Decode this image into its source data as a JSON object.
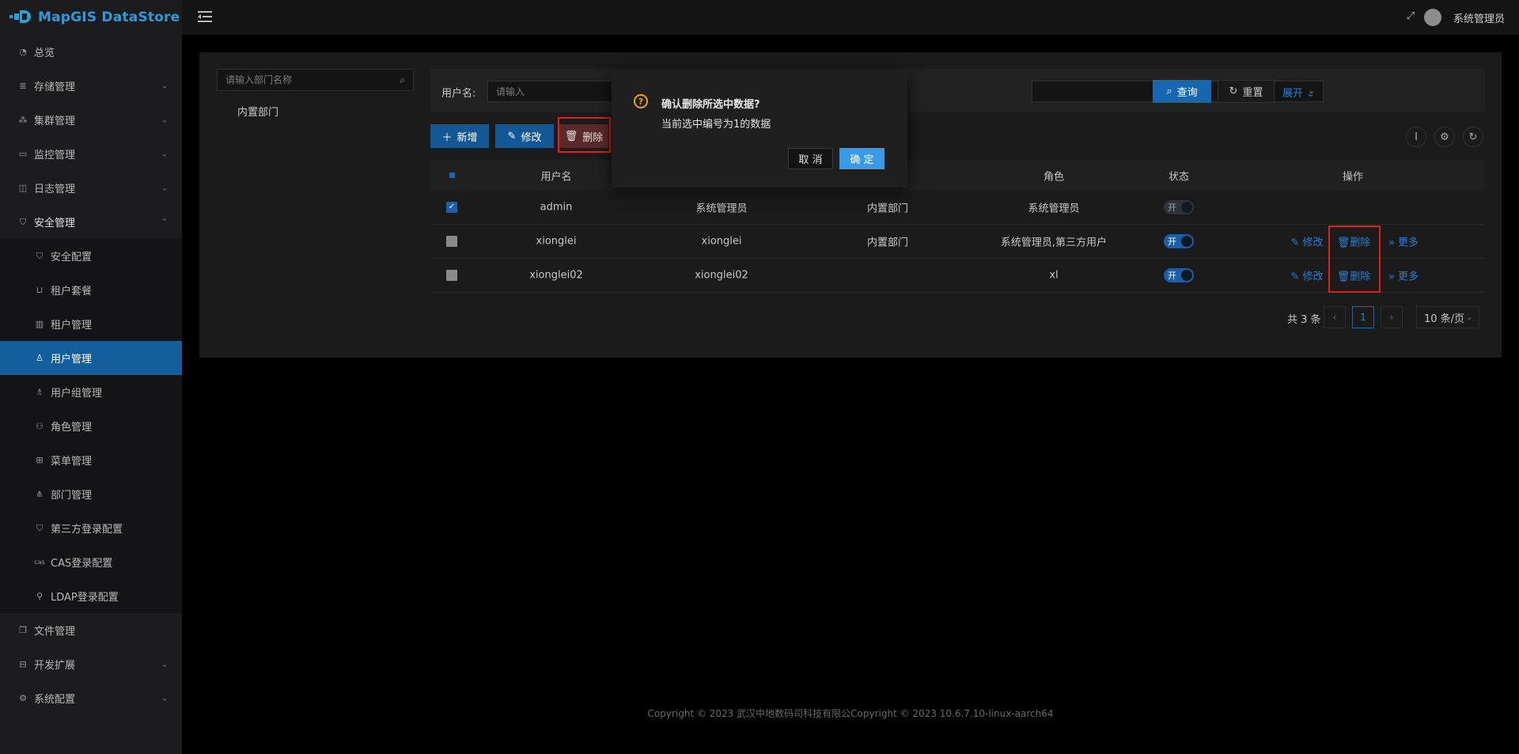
{
  "app": {
    "name": "MapGIS DataStore",
    "brand_color": "#2e9ad8"
  },
  "topbar": {
    "user_name": "系统管理员"
  },
  "sidebar": {
    "items": [
      {
        "label": "总览",
        "icon": "dashboard-icon"
      },
      {
        "label": "存储管理",
        "icon": "storage-icon"
      },
      {
        "label": "集群管理",
        "icon": "cluster-icon"
      },
      {
        "label": "监控管理",
        "icon": "monitor-icon"
      },
      {
        "label": "日志管理",
        "icon": "log-icon"
      },
      {
        "label": "安全管理",
        "icon": "shield-icon"
      },
      {
        "label": "文件管理",
        "icon": "file-icon"
      },
      {
        "label": "开发扩展",
        "icon": "briefcase-icon"
      },
      {
        "label": "系统配置",
        "icon": "gear-icon"
      }
    ],
    "security_sub": [
      {
        "label": "安全配置",
        "icon": "shield-icon"
      },
      {
        "label": "租户套餐",
        "icon": "cart-icon"
      },
      {
        "label": "租户管理",
        "icon": "building-icon"
      },
      {
        "label": "用户管理",
        "icon": "user-icon"
      },
      {
        "label": "用户组管理",
        "icon": "users-icon"
      },
      {
        "label": "角色管理",
        "icon": "role-icon"
      },
      {
        "label": "菜单管理",
        "icon": "menu-icon"
      },
      {
        "label": "部门管理",
        "icon": "org-icon"
      },
      {
        "label": "第三方登录配置",
        "icon": "shield-icon"
      },
      {
        "label": "CAS登录配置",
        "icon": "cas-icon"
      },
      {
        "label": "LDAP登录配置",
        "icon": "ldap-icon"
      }
    ],
    "active_item": "用户管理",
    "active_color": "#135e9c"
  },
  "dept_tree": {
    "search_placeholder": "请输入部门名称",
    "nodes": [
      "内置部门"
    ]
  },
  "filter": {
    "username_label": "用户名:",
    "username_placeholder": "请输入",
    "query_label": "查询",
    "reset_label": "重置",
    "expand_label": "展开"
  },
  "toolbar": {
    "add_label": "新增",
    "edit_label": "修改",
    "delete_label": "删除"
  },
  "table": {
    "headers": {
      "username": "用户名",
      "role": "角色",
      "status": "状态",
      "actions": "操作"
    },
    "rows": [
      {
        "username": "admin",
        "nickname": "系统管理员",
        "dept": "内置部门",
        "role": "系统管理员",
        "status": "开",
        "checked": true,
        "disabled": true
      },
      {
        "username": "xionglei",
        "nickname": "xionglei",
        "dept": "内置部门",
        "role": "系统管理员,第三方用户",
        "status": "开",
        "checked": false,
        "disabled": false
      },
      {
        "username": "xionglei02",
        "nickname": "xionglei02",
        "dept": "",
        "role": "xl",
        "status": "开",
        "checked": false,
        "disabled": false
      }
    ],
    "action_labels": {
      "edit": "修改",
      "delete": "删除",
      "more": "更多"
    }
  },
  "pagination": {
    "total_text": "共 3 条",
    "current_page": "1",
    "page_size": "10 条/页"
  },
  "popconfirm": {
    "title": "确认删除所选中数据?",
    "description": "当前选中编号为1的数据",
    "cancel_label": "取 消",
    "ok_label": "确 定",
    "warning_color": "#f0a020"
  },
  "footer": {
    "text": "Copyright © 2023 武汉中地数码司科技有限公Copyright © 2023 10.6.7.10-linux-aarch64"
  }
}
